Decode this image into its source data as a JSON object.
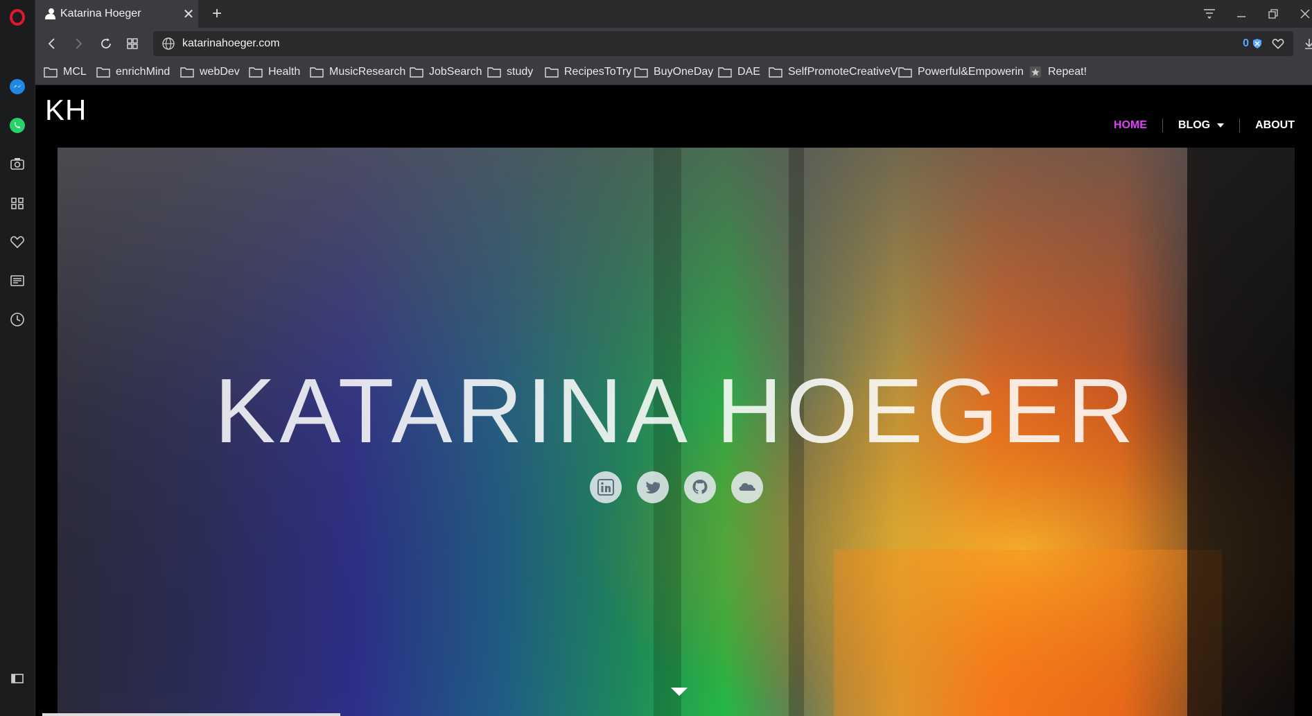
{
  "browser": {
    "tab_title": "Katarina Hoeger",
    "url": "katarinahoeger.com",
    "blocked_ads_count": "0",
    "bookmarks": [
      {
        "label": "MCL"
      },
      {
        "label": "enrichMind"
      },
      {
        "label": "webDev"
      },
      {
        "label": "Health"
      },
      {
        "label": "MusicResearch"
      },
      {
        "label": "JobSearch"
      },
      {
        "label": "study"
      },
      {
        "label": "RecipesToTry"
      },
      {
        "label": "BuyOneDay"
      },
      {
        "label": "DAE"
      },
      {
        "label": "SelfPromoteCreativeV"
      },
      {
        "label": "Powerful&Empowerin"
      },
      {
        "label": "Repeat!"
      }
    ],
    "sidebar_icons": [
      "opera-logo-icon",
      "messenger-icon",
      "whatsapp-icon",
      "camera-icon",
      "speed-dial-icon",
      "heart-icon",
      "news-icon",
      "history-icon",
      "sidebar-toggle-icon"
    ]
  },
  "site": {
    "logo": "KH",
    "nav": [
      {
        "label": "HOME",
        "active": true
      },
      {
        "label": "BLOG"
      },
      {
        "label": "ABOUT"
      }
    ],
    "hero_name": "KATARINA HOEGER",
    "socials": [
      "linkedin-icon",
      "twitter-icon",
      "github-icon",
      "soundcloud-icon"
    ]
  },
  "colors": {
    "nav_active": "#e040fb",
    "background": "#000000"
  }
}
